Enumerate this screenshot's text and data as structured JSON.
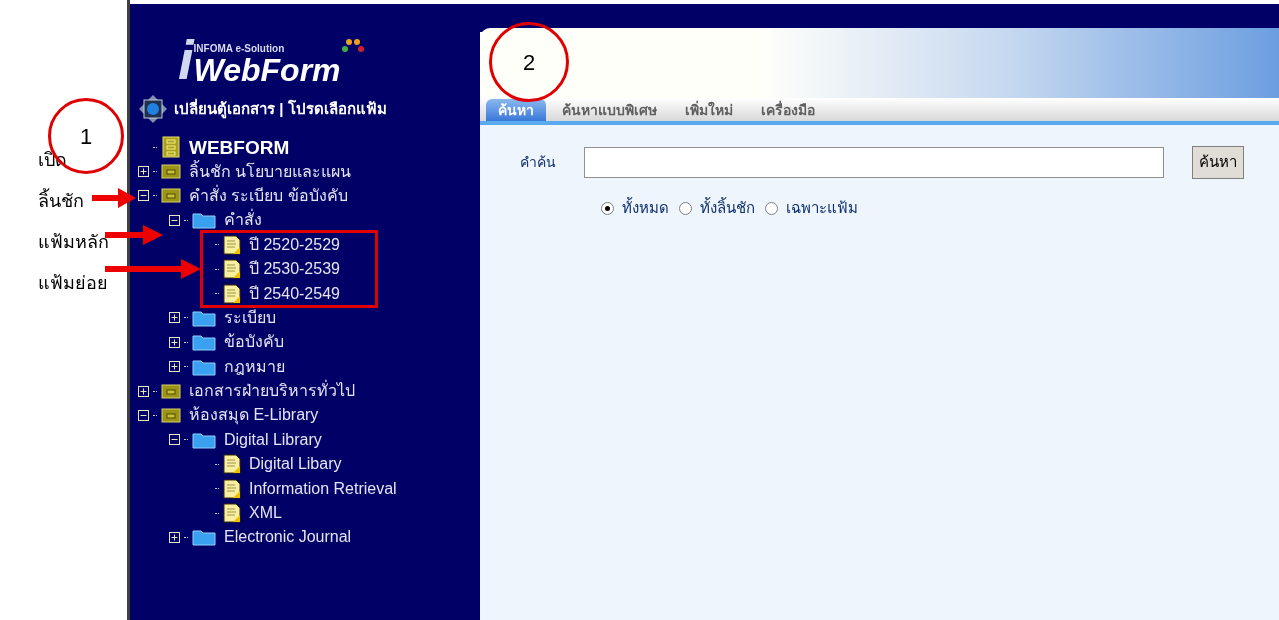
{
  "logo": {
    "initial": "i",
    "tagline": "INFOMA e-Solution",
    "brand": "WebForm"
  },
  "sidebar": {
    "header": "เปลี่ยนตู้เอกสาร | โปรดเลือกแฟ้ม",
    "tree": [
      {
        "label": "WEBFORM",
        "kind": "root"
      },
      {
        "label": "ลิ้นชัก นโยบายและแผน",
        "kind": "drawer",
        "expanded": false
      },
      {
        "label": "คำสั่ง ระเบียบ ข้อบังคับ",
        "kind": "drawer",
        "expanded": true,
        "children": [
          {
            "label": "คำสั่ง",
            "kind": "folder",
            "expanded": true,
            "children": [
              {
                "label": "ปี 2520-2529",
                "kind": "doc"
              },
              {
                "label": "ปี 2530-2539",
                "kind": "doc"
              },
              {
                "label": "ปี 2540-2549",
                "kind": "doc"
              }
            ]
          },
          {
            "label": "ระเบียบ",
            "kind": "folder",
            "expanded": false
          },
          {
            "label": "ข้อบังคับ",
            "kind": "folder",
            "expanded": false
          },
          {
            "label": "กฎหมาย",
            "kind": "folder",
            "expanded": false
          }
        ]
      },
      {
        "label": "เอกสารฝ่ายบริหารทั่วไป",
        "kind": "drawer",
        "expanded": false
      },
      {
        "label": "ห้องสมุด E-Library",
        "kind": "drawer",
        "expanded": true,
        "children": [
          {
            "label": "Digital Library",
            "kind": "folder",
            "expanded": true,
            "children": [
              {
                "label": "Digital Libary",
                "kind": "doc"
              },
              {
                "label": "Information Retrieval",
                "kind": "doc"
              },
              {
                "label": "XML",
                "kind": "doc"
              }
            ]
          },
          {
            "label": "Electronic Journal",
            "kind": "folder",
            "expanded": false
          }
        ]
      }
    ]
  },
  "tabs": [
    {
      "label": "ค้นหา",
      "selected": true
    },
    {
      "label": "ค้นหาแบบพิเศษ",
      "selected": false
    },
    {
      "label": "เพิ่มใหม่",
      "selected": false
    },
    {
      "label": "เครื่องมือ",
      "selected": false
    }
  ],
  "search": {
    "label": "คำค้น",
    "button": "ค้นหา",
    "options": [
      {
        "label": "ทั้งหมด",
        "selected": true
      },
      {
        "label": "ทั้งลิ้นชัก",
        "selected": false
      },
      {
        "label": "เฉพาะแฟ้ม",
        "selected": false
      }
    ]
  },
  "annotations": {
    "circles": [
      "1",
      "2"
    ],
    "labels": [
      "เปิด",
      "ลิ้นชัก",
      "แฟ้มหลัก",
      "แฟ้มย่อย"
    ]
  }
}
